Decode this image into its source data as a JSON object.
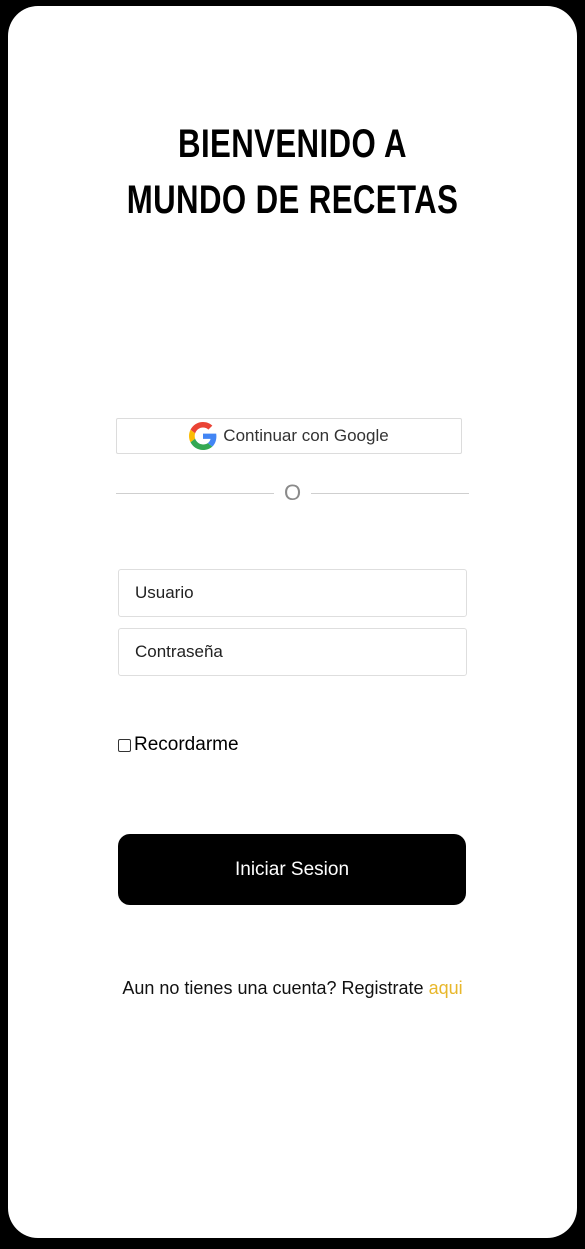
{
  "header": {
    "title_line1": "BIENVENIDO A",
    "title_line2": "MUNDO DE RECETAS"
  },
  "google": {
    "label": "Continuar con Google",
    "icon": "google-icon"
  },
  "divider": {
    "label": "O"
  },
  "form": {
    "username_placeholder": "Usuario",
    "password_placeholder": "Contraseña",
    "remember_label": "Recordarme",
    "submit_label": "Iniciar Sesion"
  },
  "signup": {
    "prompt": "Aun no tienes una cuenta? Registrate",
    "link_label": "aqui",
    "link_color": "#e8b72b"
  }
}
